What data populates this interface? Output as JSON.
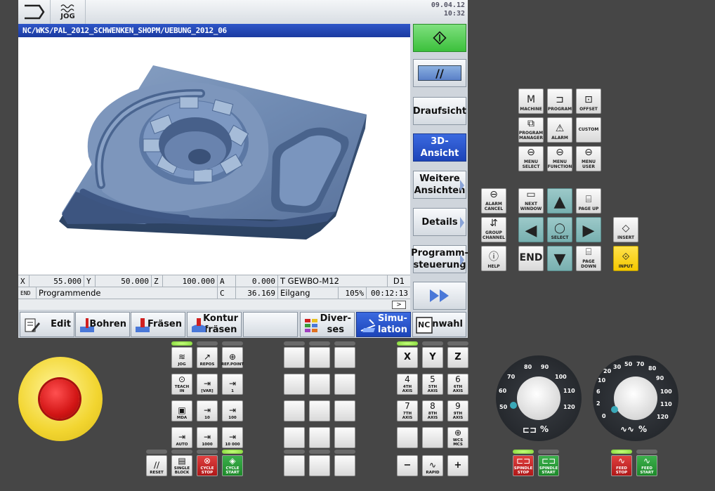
{
  "header": {
    "mode_label": "JOG",
    "date": "09.04.12",
    "time": "10:32"
  },
  "program_path": "NC/WKS/PAL_2012_SCHWENKEN_SHOPM/UEBUNG_2012_06",
  "status": {
    "x_label": "X",
    "x_value": "55.000",
    "y_label": "Y",
    "y_value": "50.000",
    "z_label": "Z",
    "z_value": "100.000",
    "a_label": "A",
    "a_value": "0.000",
    "tool": "T GEWBO-M12",
    "d_value": "D1",
    "line_label": "END",
    "line_text": "Programmende",
    "c_label": "C",
    "c_value": "36.169",
    "feed_mode": "Eilgang",
    "override": "105%",
    "runtime": "00:12:13",
    "scroll_symbol": ">"
  },
  "vertical_softkeys": [
    {
      "label": "",
      "type": "start"
    },
    {
      "label": "//",
      "type": "reset"
    },
    {
      "label": "Draufsicht"
    },
    {
      "label": "3D-\nAnsicht",
      "active": true
    },
    {
      "label": "Weitere\nAnsichten"
    },
    {
      "label": "Details"
    },
    {
      "label": "Programm-\nsteuerung"
    },
    {
      "label": "",
      "type": "fast"
    }
  ],
  "horizontal_softkeys": [
    {
      "label": "Edit"
    },
    {
      "label": "Bohren"
    },
    {
      "label": "Fräsen"
    },
    {
      "label": "Kontur\nfräsen"
    },
    {
      "label": ""
    },
    {
      "label": "Diver-\nses"
    },
    {
      "label": "Simu-\nlation",
      "active": true
    },
    {
      "label": "Anwahl"
    }
  ],
  "machine_keys": {
    "machine": "MACHINE",
    "program": "PROGRAM",
    "offset": "OFFSET",
    "program_manager": "PROGRAM MANAGER",
    "alarm": "ALARM",
    "custom": "CUSTOM",
    "menu_select": "MENU SELECT",
    "menu_function": "MENU FUNCTION",
    "menu_user": "MENU USER",
    "alarm_cancel": "ALARM CANCEL",
    "next_window": "NEXT WINDOW",
    "page_up": "PAGE UP",
    "group_channel": "GROUP CHANNEL",
    "select": "SELECT",
    "insert": "INSERT",
    "help": "HELP",
    "end": "END",
    "page_down": "PAGE DOWN",
    "input": "INPUT"
  },
  "mode_keys": {
    "jog": "JOG",
    "repos": "REPOS",
    "refpoint": "REF.POINT",
    "teach_in": "TEACH IN",
    "var": "[VAR]",
    "inc1": "1",
    "mda": "MDA",
    "inc10": "10",
    "inc100": "100",
    "auto": "AUTO",
    "inc1000": "1000",
    "inc10000": "10 000",
    "reset": "RESET",
    "single_block": "SINGLE BLOCK",
    "cycle_stop": "CYCLE STOP",
    "cycle_start": "CYCLE START"
  },
  "axis_keys": {
    "x": "X",
    "y": "Y",
    "z": "Z",
    "ax4": "4",
    "ax4_sub": "4TH AXIS",
    "ax5": "5",
    "ax5_sub": "5TH AXIS",
    "ax6": "6",
    "ax6_sub": "6TH AXIS",
    "ax7": "7",
    "ax7_sub": "7TH AXIS",
    "ax8": "8",
    "ax8_sub": "8TH AXIS",
    "ax9": "9",
    "ax9_sub": "9TH AXIS",
    "wcs_mcs": "WCS MCS",
    "minus": "−",
    "rapid": "RAPID",
    "plus": "+"
  },
  "spindle_keys": {
    "stop": "SPINDLE STOP",
    "start": "SPINDLE START"
  },
  "feed_keys": {
    "stop": "FEED STOP",
    "start": "FEED START"
  },
  "spindle_dial": {
    "ticks": [
      "50",
      "60",
      "70",
      "80",
      "90",
      "100",
      "110",
      "120"
    ],
    "unit": "%"
  },
  "feed_dial": {
    "ticks": [
      "0",
      "2",
      "6",
      "10",
      "20",
      "30",
      "50",
      "70",
      "80",
      "90",
      "100",
      "110",
      "120"
    ],
    "unit": "%"
  }
}
